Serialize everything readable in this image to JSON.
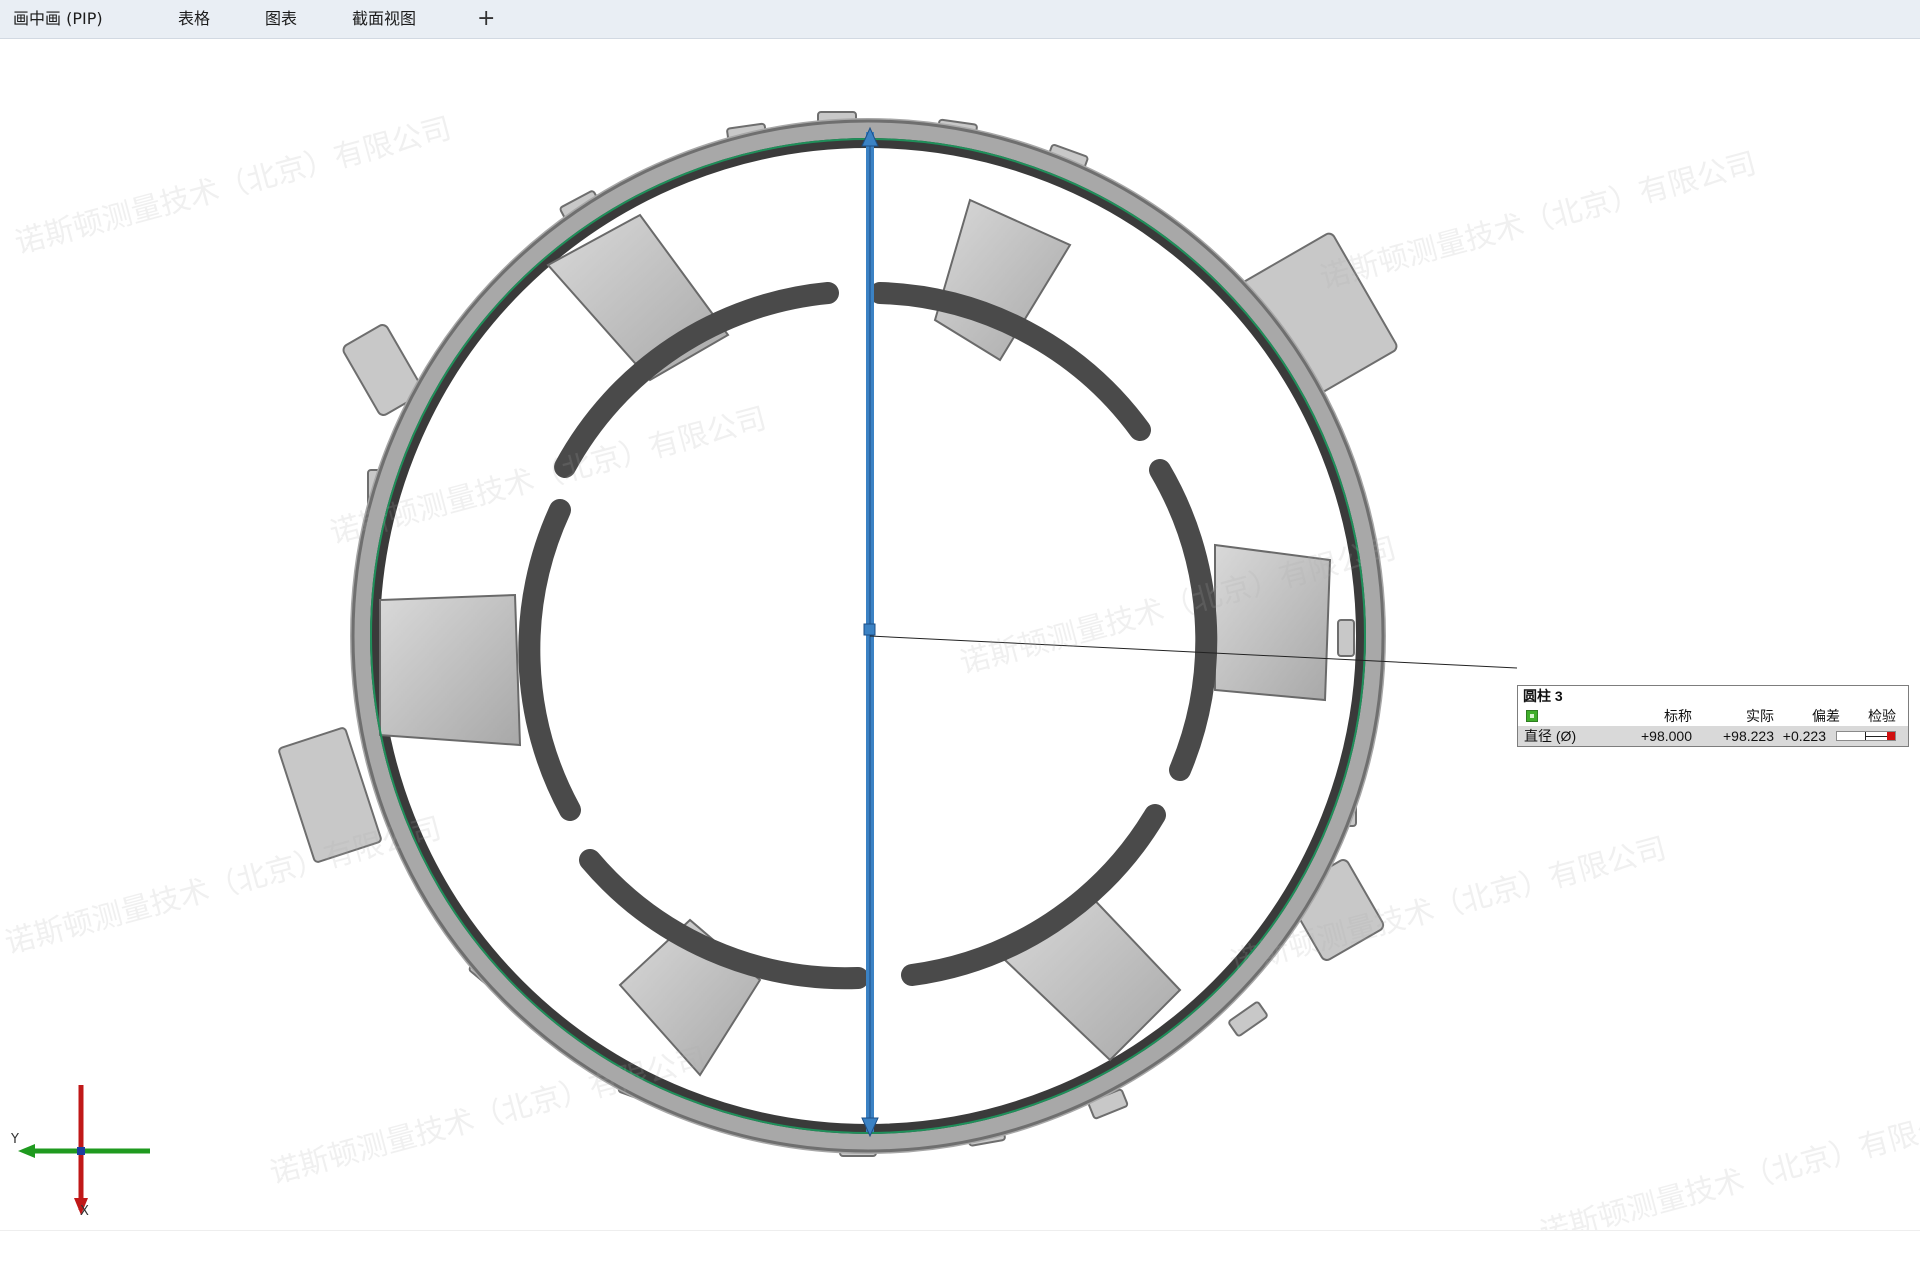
{
  "tabs": [
    {
      "label": "画中画 (PIP)"
    },
    {
      "label": "表格"
    },
    {
      "label": "图表"
    },
    {
      "label": "截面视图"
    },
    {
      "label": "+"
    }
  ],
  "watermark": {
    "text": "诺斯顿测量技术（北京）有限公司"
  },
  "label": {
    "title": "圆柱 3",
    "headers": [
      "标称",
      "实际",
      "偏差",
      "检验"
    ],
    "row_name": "直径 (Ø)",
    "nominal": "+98.000",
    "actual": "+98.223",
    "deviation": "+0.223",
    "status_color": "#3fae2a",
    "tolerance_flag_color": "#d01010"
  },
  "axes": {
    "y_label": "Y",
    "x_label": "X",
    "y_color": "#1f9a1f",
    "x_color": "#c01818"
  },
  "colors": {
    "fitted_circle": "#1f8f5a",
    "measure_line": "#3b82c4",
    "part": "#9a9a9a"
  }
}
